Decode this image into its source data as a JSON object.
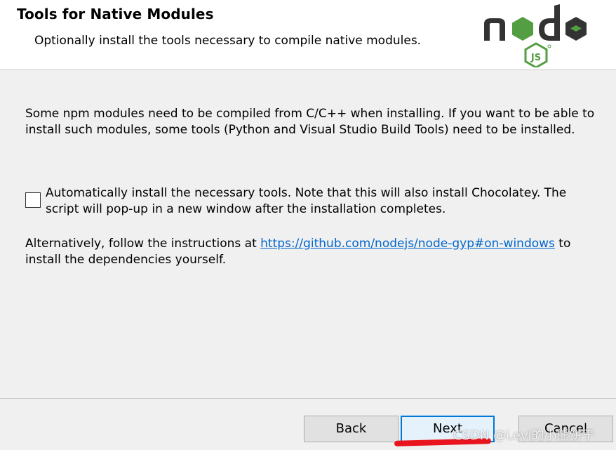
{
  "header": {
    "title": "Tools for Native Modules",
    "subtitle": "Optionally install the tools necessary to compile native modules.",
    "logo": {
      "name": "node-js-logo",
      "colors": {
        "text": "#333333",
        "accent": "#539e43"
      }
    }
  },
  "content": {
    "paragraph1": "Some npm modules need to be compiled from C/C++ when installing. If you want to be able to install such modules, some tools (Python and Visual Studio Build Tools) need to be installed.",
    "checkbox": {
      "checked": false,
      "label": "Automatically install the necessary tools. Note that this will also install Chocolatey. The script will pop-up in a new window after the installation completes."
    },
    "paragraph3": {
      "before": "Alternatively, follow the instructions at ",
      "link": "https://github.com/nodejs/node-gyp#on-windows",
      "after": " to install the dependencies yourself."
    }
  },
  "footer": {
    "back_label": "Back",
    "next_label": "Next",
    "cancel_label": "Cancel"
  },
  "watermark": "CSDN @Levi的小熊饼干",
  "colors": {
    "link": "#0066cc",
    "focus_border": "#0078d7",
    "annotation_red": "#e8141e"
  }
}
